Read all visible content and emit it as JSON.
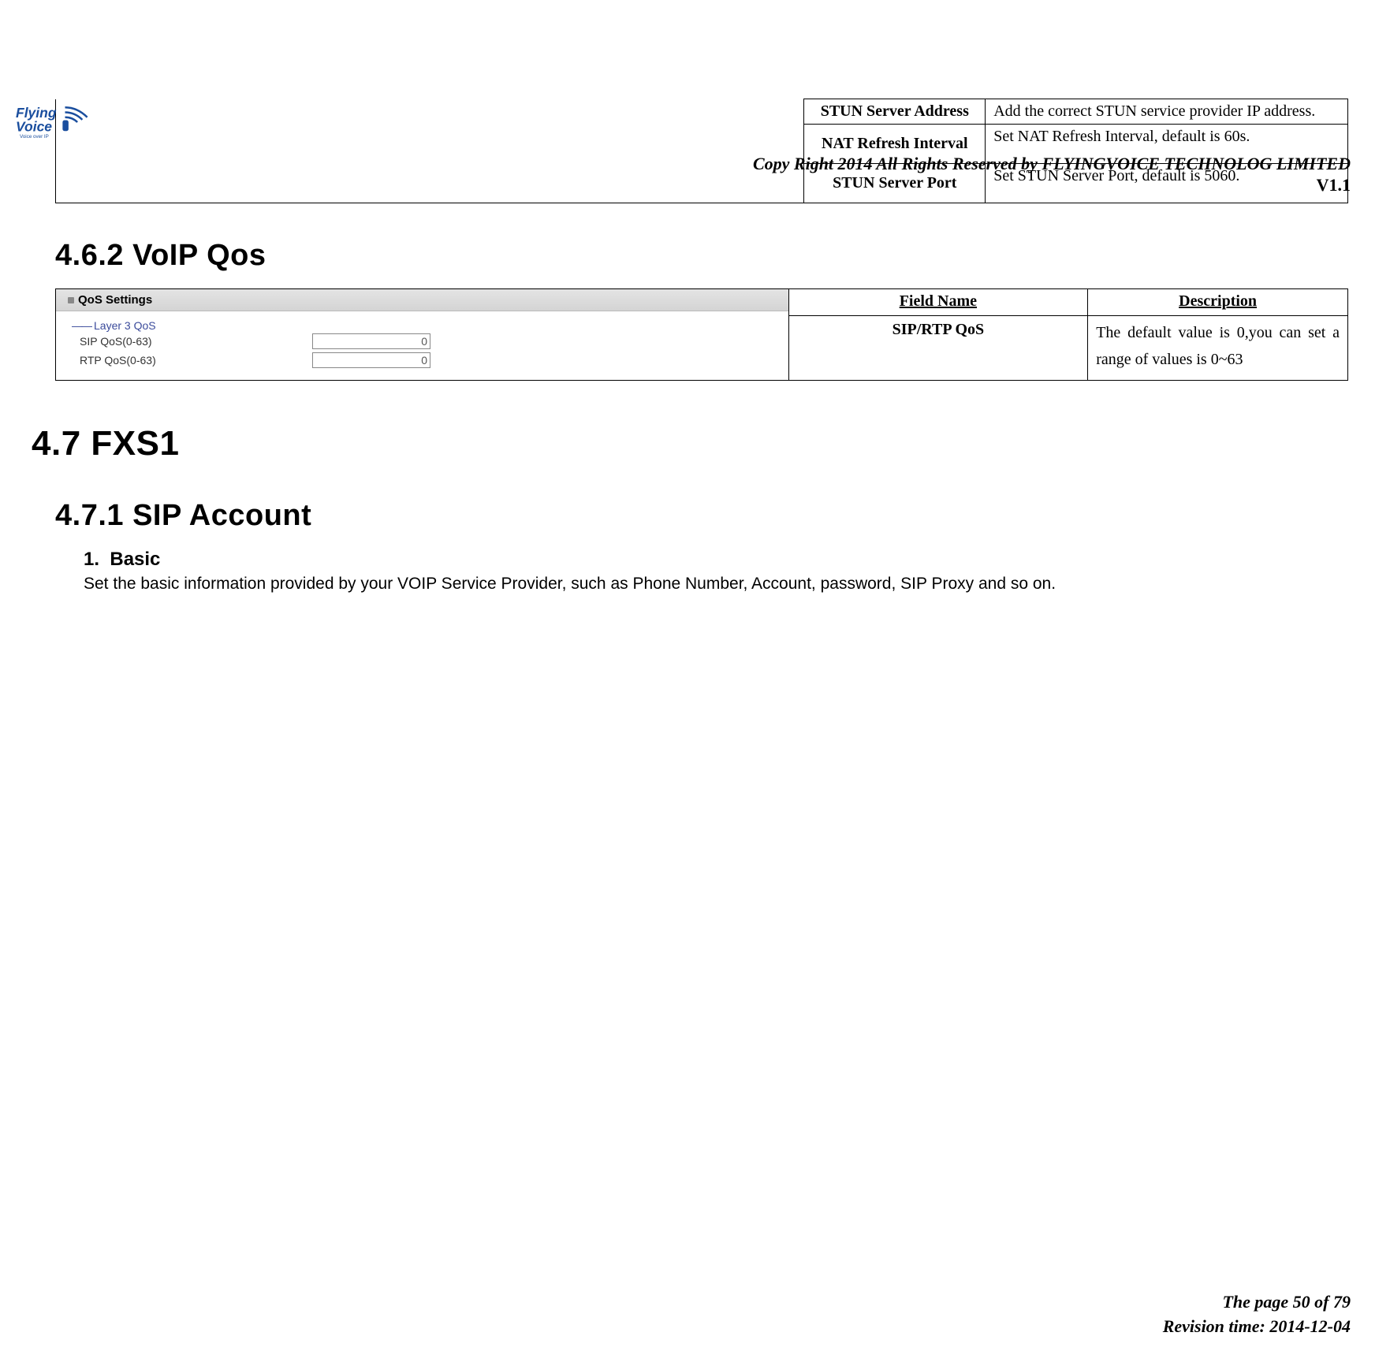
{
  "header": {
    "copyright": "Copy Right 2014 All Rights Reserved by FLYINGVOICE TECHNOLOG LIMITED",
    "version": "V1.1",
    "logo_alt": "Flying Voice - Voice over IP"
  },
  "tbl1": {
    "rows": [
      {
        "field": "STUN Server Address",
        "desc": "Add the correct STUN service provider IP address."
      },
      {
        "field": "NAT Refresh Interval",
        "desc": "Set NAT Refresh Interval, default is 60s."
      },
      {
        "field": "STUN Server Port",
        "desc": "Set STUN Server Port, default is 5060."
      }
    ]
  },
  "headings": {
    "h462": "4.6.2 VoIP Qos",
    "h47": "4.7  FXS1",
    "h471": "4.7.1 SIP Account"
  },
  "tbl2": {
    "head_field": "Field Name",
    "head_desc": "Description",
    "qos_settings_label": "QoS Settings",
    "layer3_label": "Layer 3 QoS",
    "sip_qos_label": "SIP QoS(0-63)",
    "sip_qos_value": "0",
    "rtp_qos_label": "RTP QoS(0-63)",
    "rtp_qos_value": "0",
    "row_field": "SIP/RTP QoS",
    "row_desc": "The default value is 0,you can set a range of values is 0~63"
  },
  "sip_account": {
    "sec1_num": "1.",
    "sec1_title": "Basic",
    "sec1_body": "Set the basic information provided by your VOIP Service Provider, such as Phone Number, Account, password, SIP Proxy and so on."
  },
  "footer": {
    "page": "The page 50 of 79",
    "revision": "Revision time: 2014-12-04"
  }
}
